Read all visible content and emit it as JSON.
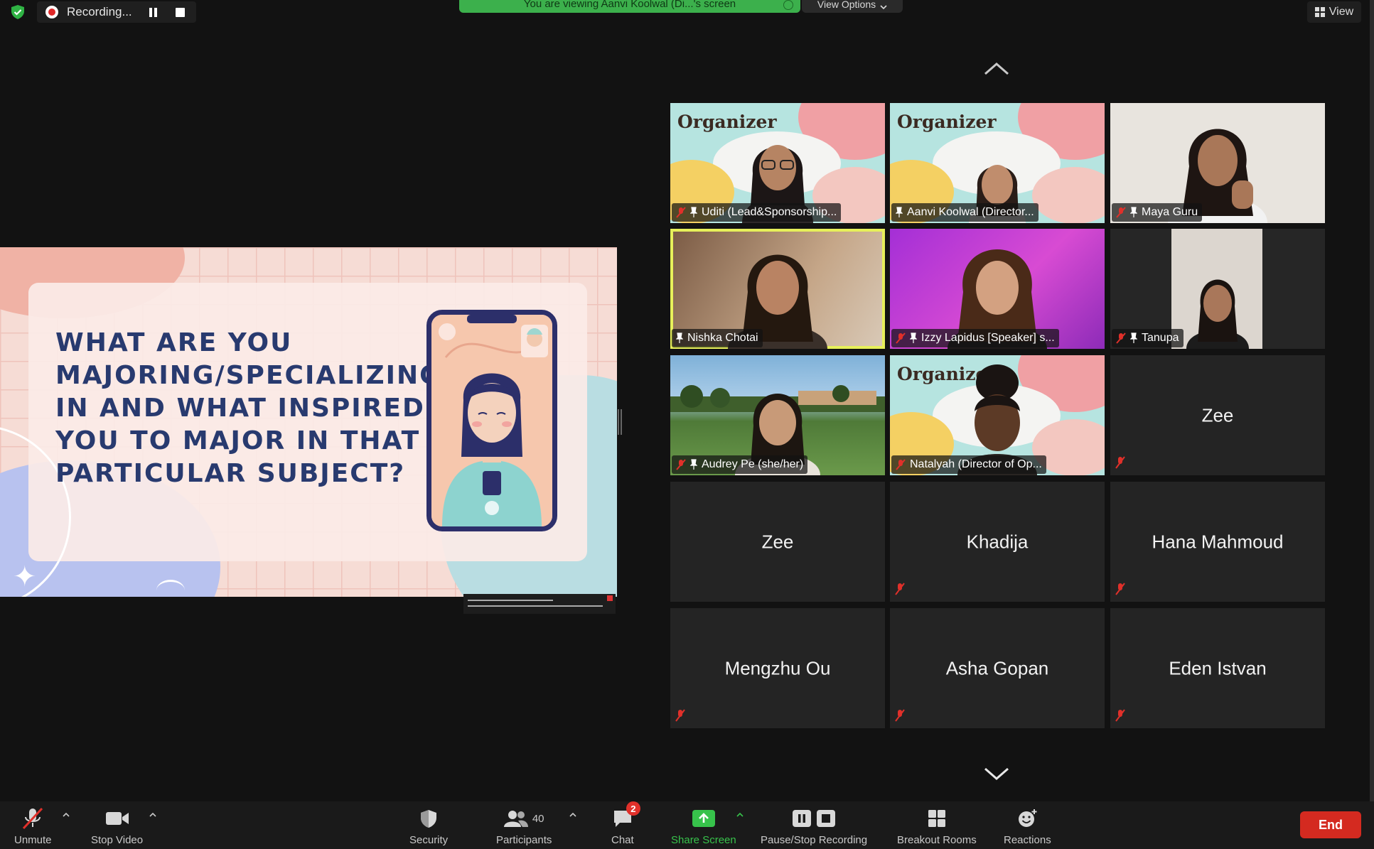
{
  "recording": {
    "label": "Recording..."
  },
  "banner": {
    "viewing_text": "You are viewing Aanvi Koolwal (Di...'s screen",
    "view_options": "View Options"
  },
  "view_button": {
    "label": "View"
  },
  "slide": {
    "question": "What are you\nmajoring/specializing\nin and what inspired\nyou to major in that\nparticular subject?"
  },
  "gallery": {
    "tiles": [
      {
        "name": "Uditi (Lead&Sponsorship...",
        "overlay": "Organizer",
        "muted": true
      },
      {
        "name": "Aanvi Koolwal (Director...",
        "overlay": "Organizer",
        "muted": false
      },
      {
        "name": "Maya Guru",
        "muted": true
      },
      {
        "name": "Nishka Chotai",
        "muted": false,
        "active_speaker": true
      },
      {
        "name": "Izzy Lapidus [Speaker] s...",
        "muted": true
      },
      {
        "name": "Tanupa",
        "muted": true
      },
      {
        "name": "Audrey Pe (she/her)",
        "muted": true
      },
      {
        "name": "Natalyah (Director of Op...",
        "overlay": "Organizer",
        "muted": true
      },
      {
        "name": "Zee",
        "muted": true
      },
      {
        "name": "Zee",
        "muted": false
      },
      {
        "name": "Khadija",
        "muted": true
      },
      {
        "name": "Hana Mahmoud",
        "muted": true
      },
      {
        "name": "Mengzhu Ou",
        "muted": true
      },
      {
        "name": "Asha Gopan",
        "muted": true
      },
      {
        "name": "Eden Istvan",
        "muted": true
      }
    ]
  },
  "toolbar": {
    "unmute": "Unmute",
    "stop_video": "Stop Video",
    "security": "Security",
    "participants": "Participants",
    "participants_count": "40",
    "chat": "Chat",
    "chat_badge": "2",
    "share_screen": "Share Screen",
    "pause_stop_recording": "Pause/Stop Recording",
    "breakout_rooms": "Breakout Rooms",
    "reactions": "Reactions",
    "end": "End"
  },
  "colors": {
    "active_speaker_border": "#e7f05a",
    "share_green": "#37c24b",
    "end_red": "#d42a20",
    "recording_red": "#e02828"
  }
}
